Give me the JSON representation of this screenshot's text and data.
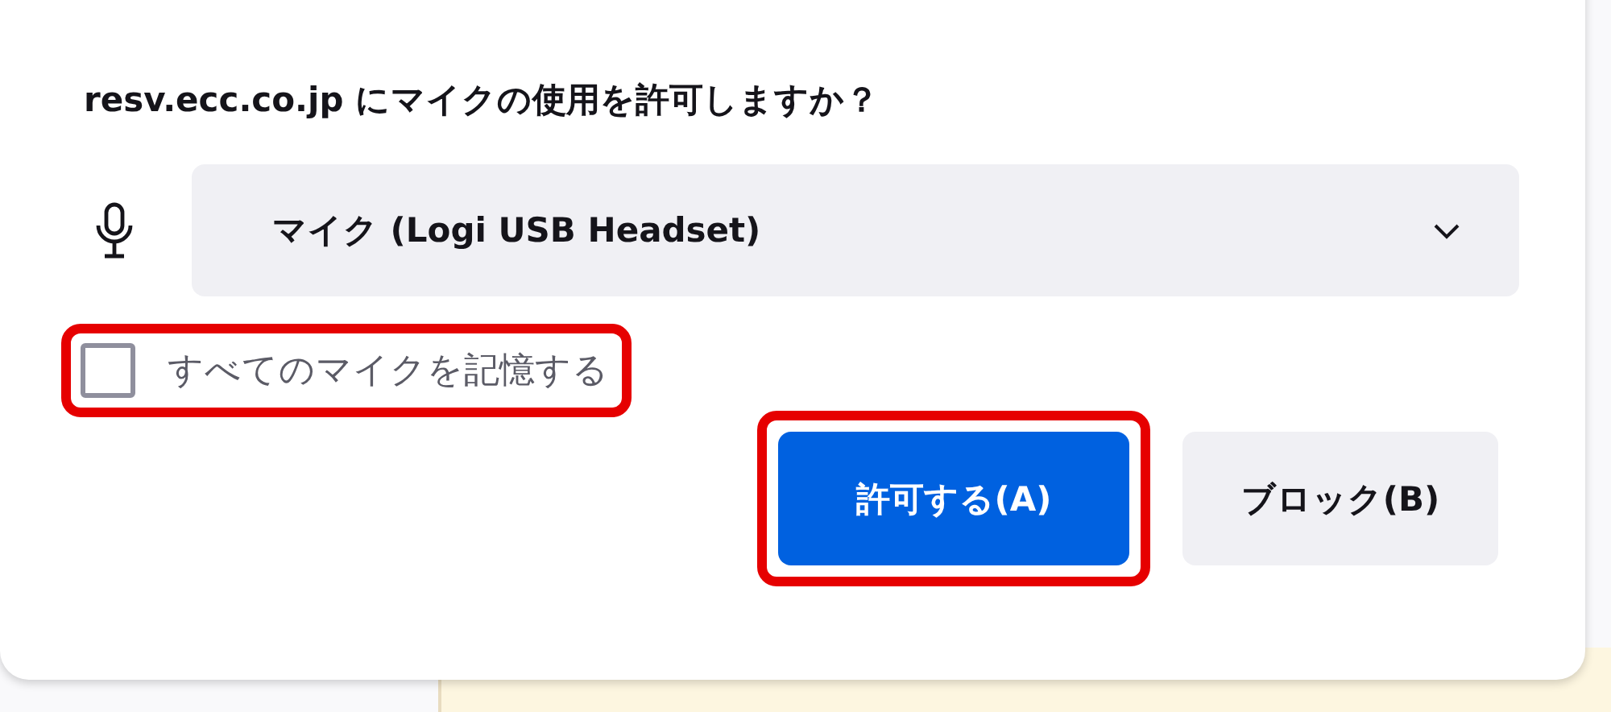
{
  "prompt": {
    "title": "resv.ecc.co.jp にマイクの使用を許可しますか？",
    "device_select": {
      "value": "マイク (Logi USB Headset)"
    },
    "remember_checkbox": {
      "label": "すべてのマイクを記憶する",
      "checked": false,
      "highlighted": true
    },
    "buttons": [
      {
        "label": "許可する(A)",
        "kind": "primary",
        "highlighted": true
      },
      {
        "label": "ブロック(B)",
        "kind": "secondary",
        "highlighted": false
      }
    ]
  }
}
